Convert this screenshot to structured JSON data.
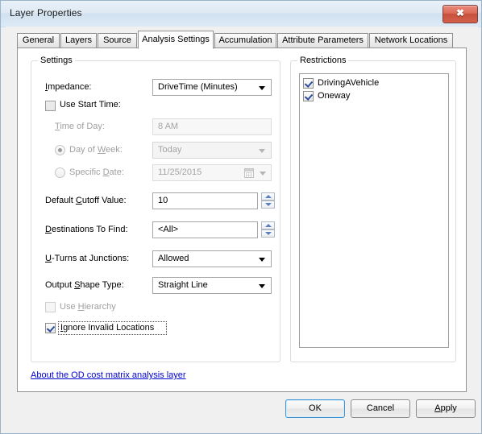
{
  "window": {
    "title": "Layer Properties",
    "close_label": "✖"
  },
  "tabs": [
    {
      "label": "General",
      "selected": false
    },
    {
      "label": "Layers",
      "selected": false
    },
    {
      "label": "Source",
      "selected": false
    },
    {
      "label": "Analysis Settings",
      "selected": true
    },
    {
      "label": "Accumulation",
      "selected": false
    },
    {
      "label": "Attribute Parameters",
      "selected": false
    },
    {
      "label": "Network Locations",
      "selected": false
    }
  ],
  "settings": {
    "title": "Settings",
    "impedance": {
      "label": "Impedance:",
      "value": "DriveTime (Minutes)"
    },
    "use_start_time": {
      "label": "Use Start Time:",
      "checked": false
    },
    "time_of_day": {
      "label": "Time of Day:",
      "value": "8 AM",
      "enabled": false
    },
    "day_of_week": {
      "label": "Day of Week:",
      "value": "Today",
      "selected": true,
      "enabled": false
    },
    "specific_date": {
      "label": "Specific Date:",
      "value": "11/25/2015",
      "selected": false,
      "enabled": false
    },
    "default_cutoff": {
      "label": "Default Cutoff Value:",
      "value": "10"
    },
    "destinations_to_find": {
      "label": "Destinations To Find:",
      "value": "<All>"
    },
    "u_turns": {
      "label": "U-Turns at Junctions:",
      "value": "Allowed"
    },
    "output_shape_type": {
      "label": "Output Shape Type:",
      "value": "Straight Line"
    },
    "use_hierarchy": {
      "label": "Use Hierarchy",
      "checked": false,
      "enabled": false
    },
    "ignore_invalid_locations": {
      "label": "Ignore Invalid Locations",
      "checked": true,
      "focused": true
    }
  },
  "restrictions": {
    "title": "Restrictions",
    "items": [
      {
        "label": "DrivingAVehicle",
        "checked": true
      },
      {
        "label": "Oneway",
        "checked": true
      }
    ]
  },
  "about_link": {
    "label": "About the OD cost matrix analysis layer"
  },
  "buttons": {
    "ok": "OK",
    "cancel": "Cancel",
    "apply": "Apply"
  },
  "colors": {
    "link": "#0000d0",
    "default_button_border": "#3c93d4",
    "checkmark": "#2b4f9e",
    "spinner_arrow": "#5a7fbe",
    "close_button": "#c8503c"
  }
}
